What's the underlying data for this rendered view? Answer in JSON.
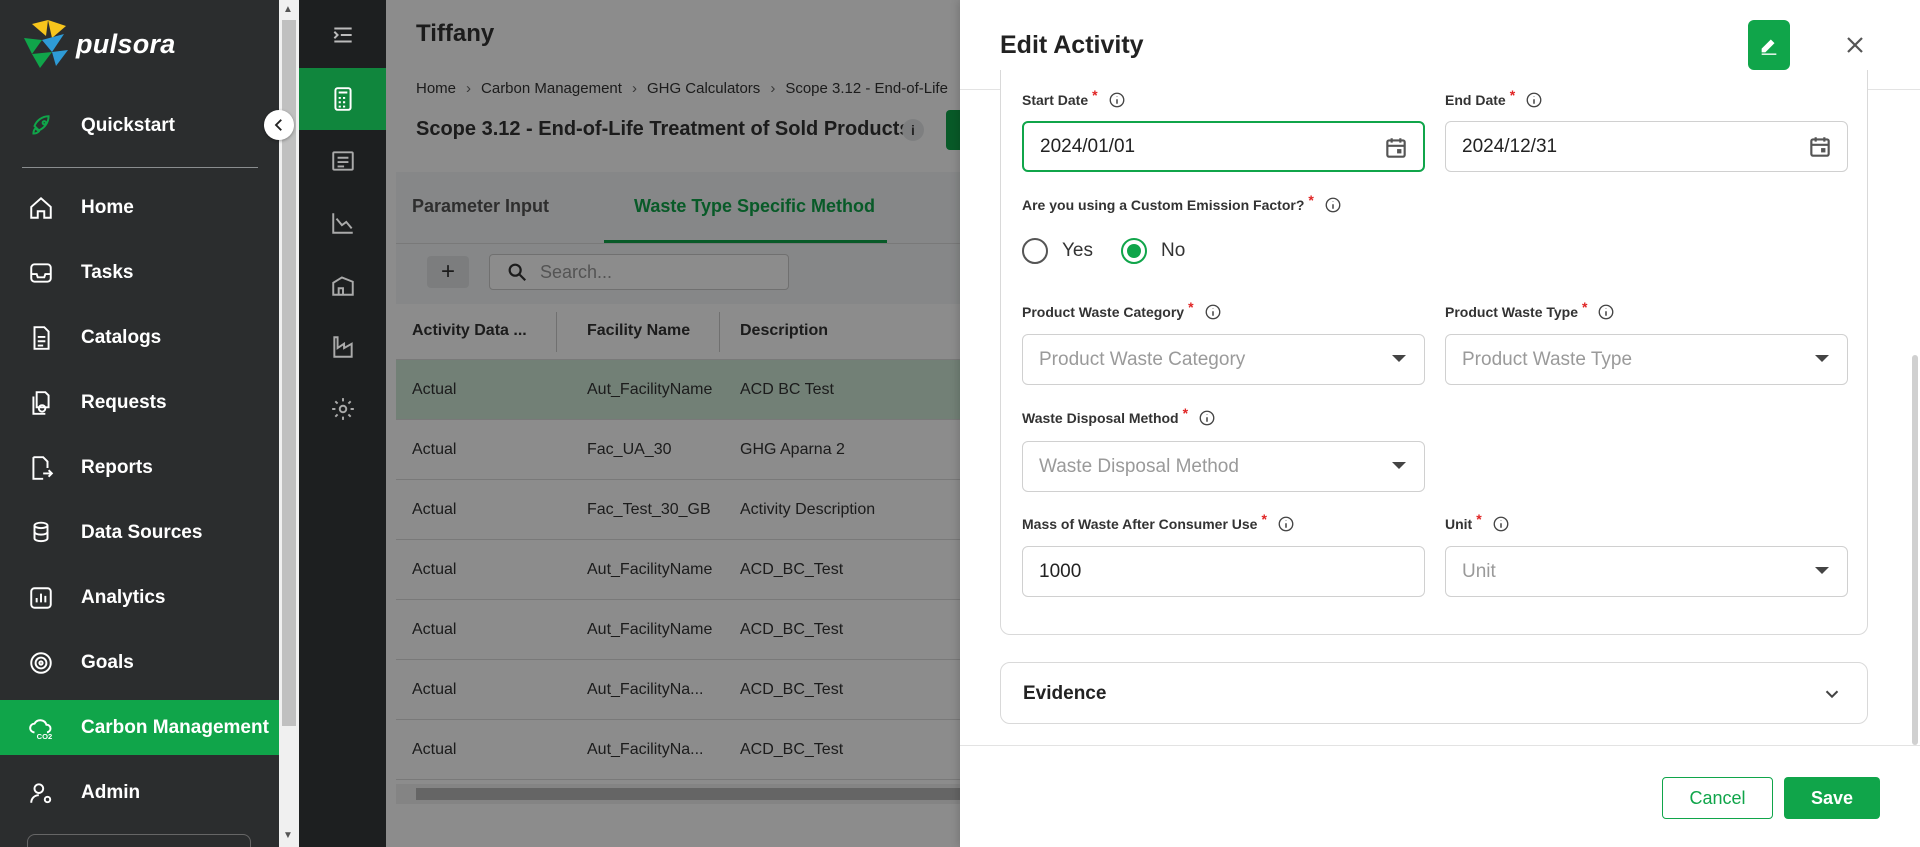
{
  "app": {
    "name": "pulsora"
  },
  "sidebar": {
    "items": [
      {
        "label": "Quickstart",
        "icon": "rocket-icon"
      },
      {
        "label": "Home",
        "icon": "home-icon"
      },
      {
        "label": "Tasks",
        "icon": "inbox-icon"
      },
      {
        "label": "Catalogs",
        "icon": "document-icon"
      },
      {
        "label": "Requests",
        "icon": "requests-icon"
      },
      {
        "label": "Reports",
        "icon": "report-export-icon"
      },
      {
        "label": "Data Sources",
        "icon": "database-icon"
      },
      {
        "label": "Analytics",
        "icon": "analytics-icon"
      },
      {
        "label": "Goals",
        "icon": "target-icon"
      },
      {
        "label": "Carbon Management",
        "icon": "cloud-co2-icon",
        "active": true
      },
      {
        "label": "Admin",
        "icon": "user-gear-icon"
      }
    ]
  },
  "rail": {
    "items": [
      "menu-collapse-icon",
      "calculator-icon",
      "ledger-icon",
      "line-chart-icon",
      "building-icon",
      "factory-icon",
      "gear-icon"
    ]
  },
  "main": {
    "title": "Tiffany",
    "breadcrumb": [
      "Home",
      "Carbon Management",
      "GHG Calculators",
      "Scope 3.12 - End-of-Life"
    ],
    "subtitle": "Scope 3.12 - End-of-Life Treatment of Sold Products",
    "info_badge": "i",
    "tabs": [
      {
        "label": "Parameter Input",
        "active": false
      },
      {
        "label": "Waste Type Specific Method",
        "active": true
      }
    ],
    "add_label": "+",
    "search_placeholder": "Search...",
    "table": {
      "columns": [
        "Activity Data ...",
        "Facility Name",
        "Description"
      ],
      "rows": [
        [
          "Actual",
          "Aut_FacilityName",
          "ACD BC Test"
        ],
        [
          "Actual",
          "Fac_UA_30",
          "GHG Aparna 2"
        ],
        [
          "Actual",
          "Fac_Test_30_GB",
          "Activity Description"
        ],
        [
          "Actual",
          "Aut_FacilityName",
          "ACD_BC_Test"
        ],
        [
          "Actual",
          "Aut_FacilityName",
          "ACD_BC_Test"
        ],
        [
          "Actual",
          "Aut_FacilityNa...",
          "ACD_BC_Test"
        ],
        [
          "Actual",
          "Aut_FacilityNa...",
          "ACD_BC_Test"
        ]
      ]
    }
  },
  "drawer": {
    "title": "Edit Activity",
    "form": {
      "start_date": {
        "label": "Start Date",
        "value": "2024/01/01"
      },
      "end_date": {
        "label": "End Date",
        "value": "2024/12/31"
      },
      "custom_ef": {
        "label": "Are you using a Custom Emission Factor?",
        "options": [
          "Yes",
          "No"
        ],
        "selected": "No"
      },
      "product_waste_category": {
        "label": "Product Waste Category",
        "placeholder": "Product Waste Category"
      },
      "product_waste_type": {
        "label": "Product Waste Type",
        "placeholder": "Product Waste Type"
      },
      "waste_disposal_method": {
        "label": "Waste Disposal Method",
        "placeholder": "Waste Disposal Method"
      },
      "mass_of_waste": {
        "label": "Mass of Waste After Consumer Use",
        "value": "1000"
      },
      "unit": {
        "label": "Unit",
        "placeholder": "Unit"
      },
      "required_mark": "*"
    },
    "evidence": {
      "title": "Evidence"
    },
    "footer": {
      "cancel_label": "Cancel",
      "save_label": "Save"
    }
  },
  "colors": {
    "brand_green": "#10a54a",
    "sidebar_bg": "#2b2d2e",
    "rail_bg": "#1d1f20",
    "required_red": "#e02424"
  }
}
